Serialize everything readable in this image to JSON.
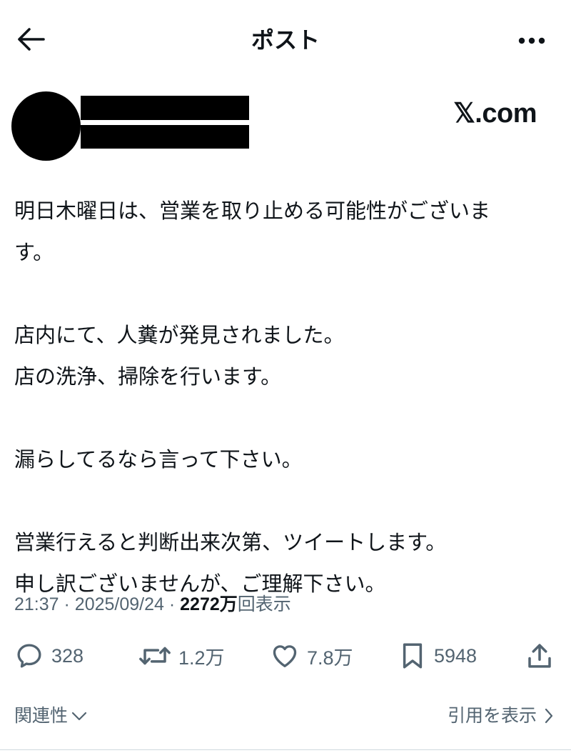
{
  "header": {
    "title": "ポスト",
    "back_icon": "arrow-left-icon",
    "more_icon": "more-horizontal-icon"
  },
  "author": {
    "brand": "𝕏.com"
  },
  "post": {
    "lines": [
      "明日木曜日は、営業を取り止める可能性がございま",
      "す。",
      "",
      "店内にて、人糞が発見されました。",
      "店の洗浄、掃除を行います。",
      "",
      "漏らしてるなら言って下さい。",
      "",
      "営業行えると判断出来次第、ツイートします。",
      "申し訳ございませんが、ご理解下さい。"
    ]
  },
  "meta": {
    "time": "21:37",
    "separator": "·",
    "date": "2025/09/24",
    "views_count": "2272万",
    "views_label": "回表示"
  },
  "actions": {
    "replies": "328",
    "reposts": "1.2万",
    "likes": "7.8万",
    "bookmarks": "5948"
  },
  "footer": {
    "related_label": "関連性",
    "quotes_label": "引用を表示"
  },
  "colors": {
    "text": "#0f1419",
    "secondary": "#536471",
    "background": "#ffffff"
  }
}
